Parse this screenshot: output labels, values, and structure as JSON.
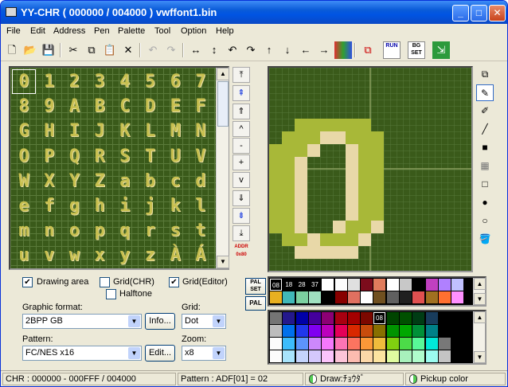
{
  "window": {
    "title": "YY-CHR ( 000000 / 004000 ) vwffont1.bin",
    "min": "_",
    "max": "□",
    "close": "✕"
  },
  "menu": [
    "File",
    "Edit",
    "Address",
    "Pen",
    "Palette",
    "Tool",
    "Option",
    "Help"
  ],
  "toolbar": {
    "new": "🗋",
    "open": "📂",
    "save": "💾",
    "cut": "✂",
    "copy": "⧉",
    "paste": "📋",
    "delete": "✕",
    "undo": "↶",
    "redo": "↷",
    "flip_h": "↔",
    "flip_v": "↕",
    "rot_l": "↶",
    "rot_r": "↷",
    "up": "↑",
    "down": "↓",
    "left": "←",
    "right": "→",
    "run": "RUN",
    "bg_set": "BG SET"
  },
  "tiles": [
    "0",
    "1",
    "2",
    "3",
    "4",
    "5",
    "6",
    "7",
    "8",
    "9",
    "A",
    "B",
    "C",
    "D",
    "E",
    "F",
    "G",
    "H",
    "I",
    "J",
    "K",
    "L",
    "M",
    "N",
    "O",
    "P",
    "Q",
    "R",
    "S",
    "T",
    "U",
    "V",
    "W",
    "X",
    "Y",
    "Z",
    "a",
    "b",
    "c",
    "d",
    "e",
    "f",
    "g",
    "h",
    "i",
    "j",
    "k",
    "l",
    "m",
    "n",
    "o",
    "p",
    "q",
    "r",
    "s",
    "t",
    "u",
    "v",
    "w",
    "x",
    "y",
    "z",
    "À",
    "Á"
  ],
  "nav": {
    "buttons": [
      "⤒",
      "⇞",
      "⇑",
      "^",
      "-",
      "+",
      "v",
      "⇓",
      "⇟",
      "⤓"
    ],
    "addr_label": "ADDR 0x80"
  },
  "options": {
    "drawing_area": "Drawing area",
    "grid_chr": "Grid(CHR)",
    "grid_editor": "Grid(Editor)",
    "halftone": "Halftone"
  },
  "format": {
    "label": "Graphic format:",
    "value": "2BPP GB",
    "info": "Info..."
  },
  "grid": {
    "label": "Grid:",
    "value": "Dot"
  },
  "pattern": {
    "label": "Pattern:",
    "value": "FC/NES x16",
    "edit": "Edit..."
  },
  "zoom": {
    "label": "Zoom:",
    "value": "x8"
  },
  "palette": {
    "pal_set": "PAL SET",
    "pal": "PAL",
    "indices": [
      "08",
      "18",
      "28",
      "37"
    ],
    "selected_index": "08"
  },
  "status": {
    "address": "CHR : 000000 - 000FFF / 004000",
    "pattern": "Pattern : ADF[01] = 02",
    "draw": "Draw:ﾁｮｳﾀﾞ",
    "pickup": "Pickup color"
  },
  "colors": {
    "bg": "#3a5a1a",
    "light": "#a8b838",
    "cream": "#e8d8a8"
  }
}
